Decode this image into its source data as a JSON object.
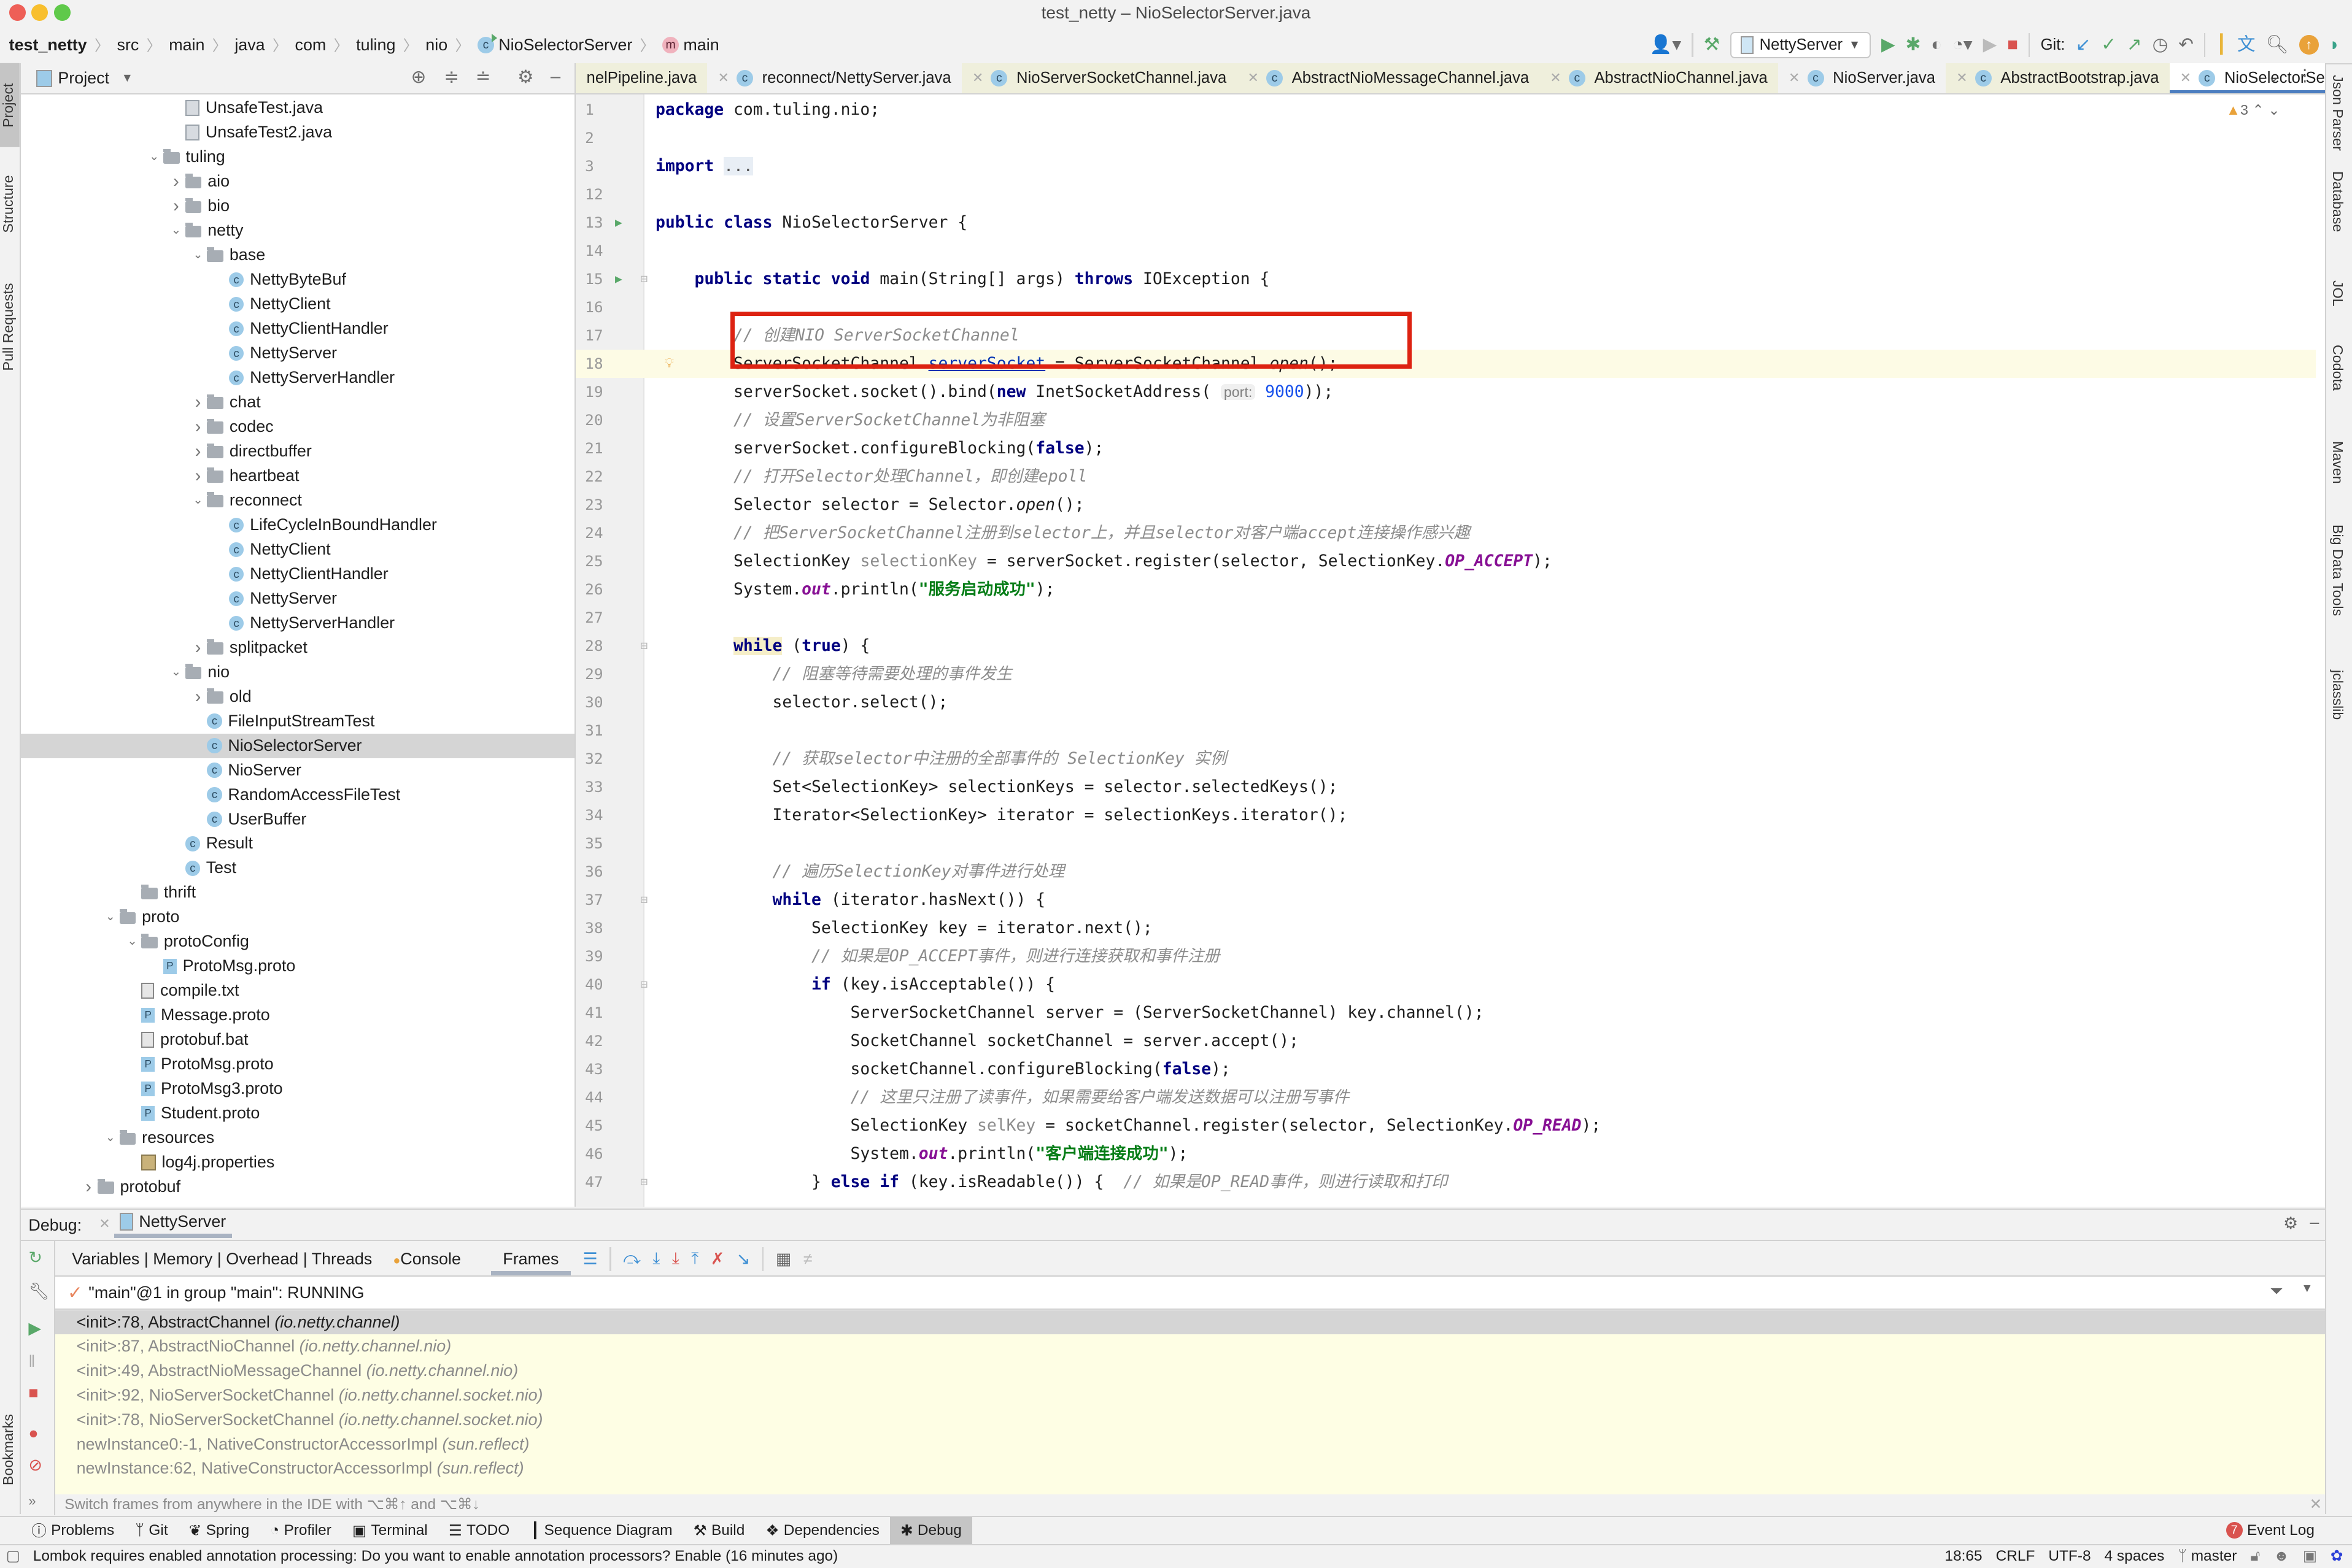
{
  "window": {
    "title": "test_netty – NioSelectorServer.java"
  },
  "colors": {
    "accent": "#4d7ec0",
    "red_box": "#dd2211",
    "close": "#ee5f57",
    "minimize": "#f8bf2e",
    "maximize": "#5fc94a"
  },
  "breadcrumb": [
    "test_netty",
    "src",
    "main",
    "java",
    "com",
    "tuling",
    "nio",
    "NioSelectorServer",
    "main"
  ],
  "toolbar": {
    "run_config": "NettyServer",
    "git_label": "Git:",
    "icons": [
      "user-icon",
      "build-hammer-icon",
      "run-icon",
      "debug-icon",
      "coverage-icon",
      "profile-icon",
      "attach-icon",
      "stop-icon",
      "git-update-icon",
      "git-commit-icon",
      "git-push-icon",
      "history-icon",
      "rollback-icon",
      "sequence-icon",
      "translate-icon",
      "search-icon",
      "update-icon",
      "plugin-icon"
    ]
  },
  "left_strip": [
    "Project",
    "Structure",
    "Pull Requests",
    "Bookmarks"
  ],
  "right_strip": [
    "Json Parser",
    "Database",
    "JOL",
    "Codota",
    "Maven",
    "Big Data Tools",
    "jclasslib"
  ],
  "project": {
    "title": "Project",
    "tree": [
      {
        "label": "UnsafeTest.java",
        "depth": 4,
        "type": "java"
      },
      {
        "label": "UnsafeTest2.java",
        "depth": 4,
        "type": "java"
      },
      {
        "label": "tuling",
        "depth": 3,
        "type": "folder",
        "state": "open"
      },
      {
        "label": "aio",
        "depth": 4,
        "type": "folder",
        "state": "closed"
      },
      {
        "label": "bio",
        "depth": 4,
        "type": "folder",
        "state": "closed"
      },
      {
        "label": "netty",
        "depth": 4,
        "type": "folder",
        "state": "open"
      },
      {
        "label": "base",
        "depth": 5,
        "type": "folder",
        "state": "open"
      },
      {
        "label": "NettyByteBuf",
        "depth": 6,
        "type": "cls"
      },
      {
        "label": "NettyClient",
        "depth": 6,
        "type": "cls"
      },
      {
        "label": "NettyClientHandler",
        "depth": 6,
        "type": "cls"
      },
      {
        "label": "NettyServer",
        "depth": 6,
        "type": "cls"
      },
      {
        "label": "NettyServerHandler",
        "depth": 6,
        "type": "cls"
      },
      {
        "label": "chat",
        "depth": 5,
        "type": "folder",
        "state": "closed"
      },
      {
        "label": "codec",
        "depth": 5,
        "type": "folder",
        "state": "closed"
      },
      {
        "label": "directbuffer",
        "depth": 5,
        "type": "folder",
        "state": "closed"
      },
      {
        "label": "heartbeat",
        "depth": 5,
        "type": "folder",
        "state": "closed"
      },
      {
        "label": "reconnect",
        "depth": 5,
        "type": "folder",
        "state": "open"
      },
      {
        "label": "LifeCycleInBoundHandler",
        "depth": 6,
        "type": "cls"
      },
      {
        "label": "NettyClient",
        "depth": 6,
        "type": "cls"
      },
      {
        "label": "NettyClientHandler",
        "depth": 6,
        "type": "cls"
      },
      {
        "label": "NettyServer",
        "depth": 6,
        "type": "cls"
      },
      {
        "label": "NettyServerHandler",
        "depth": 6,
        "type": "cls"
      },
      {
        "label": "splitpacket",
        "depth": 5,
        "type": "folder",
        "state": "closed"
      },
      {
        "label": "nio",
        "depth": 4,
        "type": "folder",
        "state": "open"
      },
      {
        "label": "old",
        "depth": 5,
        "type": "folder",
        "state": "closed"
      },
      {
        "label": "FileInputStreamTest",
        "depth": 5,
        "type": "cls"
      },
      {
        "label": "NioSelectorServer",
        "depth": 5,
        "type": "cls",
        "selected": true
      },
      {
        "label": "NioServer",
        "depth": 5,
        "type": "cls"
      },
      {
        "label": "RandomAccessFileTest",
        "depth": 5,
        "type": "cls"
      },
      {
        "label": "UserBuffer",
        "depth": 5,
        "type": "cls"
      },
      {
        "label": "Result",
        "depth": 4,
        "type": "cls"
      },
      {
        "label": "Test",
        "depth": 4,
        "type": "cls"
      },
      {
        "label": "thrift",
        "depth": 2,
        "type": "folder"
      },
      {
        "label": "proto",
        "depth": 1,
        "type": "folder",
        "state": "open"
      },
      {
        "label": "protoConfig",
        "depth": 2,
        "type": "folder",
        "state": "open"
      },
      {
        "label": "ProtoMsg.proto",
        "depth": 3,
        "type": "proto"
      },
      {
        "label": "compile.txt",
        "depth": 2,
        "type": "txt"
      },
      {
        "label": "Message.proto",
        "depth": 2,
        "type": "proto"
      },
      {
        "label": "protobuf.bat",
        "depth": 2,
        "type": "txt"
      },
      {
        "label": "ProtoMsg.proto",
        "depth": 2,
        "type": "proto"
      },
      {
        "label": "ProtoMsg3.proto",
        "depth": 2,
        "type": "proto"
      },
      {
        "label": "Student.proto",
        "depth": 2,
        "type": "proto"
      },
      {
        "label": "resources",
        "depth": 1,
        "type": "folder",
        "state": "open"
      },
      {
        "label": "log4j.properties",
        "depth": 2,
        "type": "props"
      },
      {
        "label": "protobuf",
        "depth": 0,
        "type": "folder",
        "state": "closed"
      }
    ]
  },
  "editor": {
    "tabs": [
      {
        "label": "nelPipeline.java",
        "kind": "lib"
      },
      {
        "label": "reconnect/NettyServer.java",
        "kind": "src"
      },
      {
        "label": "NioServerSocketChannel.java",
        "kind": "lib"
      },
      {
        "label": "AbstractNioMessageChannel.java",
        "kind": "lib"
      },
      {
        "label": "AbstractNioChannel.java",
        "kind": "lib"
      },
      {
        "label": "NioServer.java",
        "kind": "src"
      },
      {
        "label": "AbstractBootstrap.java",
        "kind": "lib"
      },
      {
        "label": "NioSelectorServer.java",
        "kind": "active"
      }
    ],
    "warnings": "3",
    "current_line": "18",
    "lines": [
      {
        "n": "1",
        "t": [
          [
            "kw",
            "package"
          ],
          [
            "",
            " com.tuling.nio;"
          ]
        ]
      },
      {
        "n": "2",
        "t": []
      },
      {
        "n": "3",
        "t": [
          [
            "kw",
            "import"
          ],
          [
            "",
            " "
          ],
          [
            "fold",
            "..."
          ]
        ]
      },
      {
        "n": "12",
        "t": []
      },
      {
        "n": "13",
        "t": [
          [
            "kw",
            "public class"
          ],
          [
            "",
            " NioSelectorServer {"
          ]
        ]
      },
      {
        "n": "14",
        "t": []
      },
      {
        "n": "15",
        "t": [
          [
            "",
            "    "
          ],
          [
            "kw",
            "public static void"
          ],
          [
            "",
            " main(String[] args) "
          ],
          [
            "kw",
            "throws"
          ],
          [
            "",
            " IOException {"
          ]
        ]
      },
      {
        "n": "16",
        "t": []
      },
      {
        "n": "17",
        "t": [
          [
            "",
            "        "
          ],
          [
            "cm",
            "// 创建NIO ServerSocketChannel"
          ]
        ]
      },
      {
        "n": "18",
        "t": [
          [
            "",
            "        ServerSocketChannel "
          ],
          [
            "var",
            "serverSocket"
          ],
          [
            "",
            " = ServerSocketChannel."
          ],
          [
            "it",
            "open"
          ],
          [
            "",
            "();"
          ]
        ]
      },
      {
        "n": "19",
        "t": [
          [
            "",
            "        serverSocket.socket().bind("
          ],
          [
            "kw",
            "new"
          ],
          [
            "",
            " InetSocketAddress( "
          ],
          [
            "hint",
            "port:"
          ],
          [
            "",
            " "
          ],
          [
            "num",
            "9000"
          ],
          [
            "",
            "));"
          ]
        ]
      },
      {
        "n": "20",
        "t": [
          [
            "",
            "        "
          ],
          [
            "cm",
            "// 设置ServerSocketChannel为非阻塞"
          ]
        ]
      },
      {
        "n": "21",
        "t": [
          [
            "",
            "        serverSocket.configureBlocking("
          ],
          [
            "kw",
            "false"
          ],
          [
            "",
            ");"
          ]
        ]
      },
      {
        "n": "22",
        "t": [
          [
            "",
            "        "
          ],
          [
            "cm",
            "// 打开Selector处理Channel，即创建epoll"
          ]
        ]
      },
      {
        "n": "23",
        "t": [
          [
            "",
            "        Selector selector = Selector."
          ],
          [
            "it",
            "open"
          ],
          [
            "",
            "();"
          ]
        ]
      },
      {
        "n": "24",
        "t": [
          [
            "",
            "        "
          ],
          [
            "cm",
            "// 把ServerSocketChannel注册到selector上，并且selector对客户端accept连接操作感兴趣"
          ]
        ]
      },
      {
        "n": "25",
        "t": [
          [
            "",
            "        SelectionKey "
          ],
          [
            "un",
            "selectionKey"
          ],
          [
            "",
            " = serverSocket.register(selector, SelectionKey."
          ],
          [
            "fld",
            "OP_ACCEPT"
          ],
          [
            "",
            ");"
          ]
        ]
      },
      {
        "n": "26",
        "t": [
          [
            "",
            "        System."
          ],
          [
            "fld",
            "out"
          ],
          [
            "",
            ".println("
          ],
          [
            "str",
            "\"服务启动成功\""
          ],
          [
            "",
            ");"
          ]
        ]
      },
      {
        "n": "27",
        "t": []
      },
      {
        "n": "28",
        "t": [
          [
            "",
            "        "
          ],
          [
            "kwh",
            "while"
          ],
          [
            "",
            " ("
          ],
          [
            "kw",
            "true"
          ],
          [
            "",
            ") {"
          ]
        ]
      },
      {
        "n": "29",
        "t": [
          [
            "",
            "            "
          ],
          [
            "cm",
            "// 阻塞等待需要处理的事件发生"
          ]
        ]
      },
      {
        "n": "30",
        "t": [
          [
            "",
            "            selector.select();"
          ]
        ]
      },
      {
        "n": "31",
        "t": []
      },
      {
        "n": "32",
        "t": [
          [
            "",
            "            "
          ],
          [
            "cm",
            "// 获取selector中注册的全部事件的 SelectionKey 实例"
          ]
        ]
      },
      {
        "n": "33",
        "t": [
          [
            "",
            "            Set<SelectionKey> selectionKeys = selector.selectedKeys();"
          ]
        ]
      },
      {
        "n": "34",
        "t": [
          [
            "",
            "            Iterator<SelectionKey> iterator = selectionKeys.iterator();"
          ]
        ]
      },
      {
        "n": "35",
        "t": []
      },
      {
        "n": "36",
        "t": [
          [
            "",
            "            "
          ],
          [
            "cm",
            "// 遍历SelectionKey对事件进行处理"
          ]
        ]
      },
      {
        "n": "37",
        "t": [
          [
            "",
            "            "
          ],
          [
            "kw",
            "while"
          ],
          [
            "",
            " (iterator.hasNext()) {"
          ]
        ]
      },
      {
        "n": "38",
        "t": [
          [
            "",
            "                SelectionKey key = iterator.next();"
          ]
        ]
      },
      {
        "n": "39",
        "t": [
          [
            "",
            "                "
          ],
          [
            "cm",
            "// 如果是OP_ACCEPT事件，则进行连接获取和事件注册"
          ]
        ]
      },
      {
        "n": "40",
        "t": [
          [
            "",
            "                "
          ],
          [
            "kw",
            "if"
          ],
          [
            "",
            " (key.isAcceptable()) {"
          ]
        ]
      },
      {
        "n": "41",
        "t": [
          [
            "",
            "                    ServerSocketChannel server = (ServerSocketChannel) key.channel();"
          ]
        ]
      },
      {
        "n": "42",
        "t": [
          [
            "",
            "                    SocketChannel socketChannel = server.accept();"
          ]
        ]
      },
      {
        "n": "43",
        "t": [
          [
            "",
            "                    socketChannel.configureBlocking("
          ],
          [
            "kw",
            "false"
          ],
          [
            "",
            ");"
          ]
        ]
      },
      {
        "n": "44",
        "t": [
          [
            "",
            "                    "
          ],
          [
            "cm",
            "// 这里只注册了读事件，如果需要给客户端发送数据可以注册写事件"
          ]
        ]
      },
      {
        "n": "45",
        "t": [
          [
            "",
            "                    SelectionKey "
          ],
          [
            "un",
            "selKey"
          ],
          [
            "",
            " = socketChannel.register(selector, SelectionKey."
          ],
          [
            "fld",
            "OP_READ"
          ],
          [
            "",
            ");"
          ]
        ]
      },
      {
        "n": "46",
        "t": [
          [
            "",
            "                    System."
          ],
          [
            "fld",
            "out"
          ],
          [
            "",
            ".println("
          ],
          [
            "str",
            "\"客户端连接成功\""
          ],
          [
            "",
            ");"
          ]
        ]
      },
      {
        "n": "47",
        "t": [
          [
            "",
            "                } "
          ],
          [
            "kw",
            "else if"
          ],
          [
            "",
            " (key.isReadable()) {  "
          ],
          [
            "cm",
            "// 如果是OP_READ事件，则进行读取和打印"
          ]
        ]
      }
    ]
  },
  "debug": {
    "label": "Debug:",
    "session": "NettyServer",
    "tabs": [
      "Variables | Memory | Overhead | Threads",
      "Console",
      "Frames"
    ],
    "active_tab": "Frames",
    "thread": "\"main\"@1 in group \"main\": RUNNING",
    "frames": [
      {
        "method": "<init>:78, AbstractChannel ",
        "pkg": "(io.netty.channel)",
        "selected": true
      },
      {
        "method": "<init>:87, AbstractNioChannel ",
        "pkg": "(io.netty.channel.nio)"
      },
      {
        "method": "<init>:49, AbstractNioMessageChannel ",
        "pkg": "(io.netty.channel.nio)"
      },
      {
        "method": "<init>:92, NioServerSocketChannel ",
        "pkg": "(io.netty.channel.socket.nio)"
      },
      {
        "method": "<init>:78, NioServerSocketChannel ",
        "pkg": "(io.netty.channel.socket.nio)"
      },
      {
        "method": "newInstance0:-1, NativeConstructorAccessorImpl ",
        "pkg": "(sun.reflect)"
      },
      {
        "method": "newInstance:62, NativeConstructorAccessorImpl ",
        "pkg": "(sun.reflect)"
      }
    ],
    "hint": "Switch frames from anywhere in the IDE with ⌥⌘↑ and ⌥⌘↓"
  },
  "bottom_tools": [
    {
      "label": "Problems",
      "icon": "problems-icon"
    },
    {
      "label": "Git",
      "icon": "git-icon"
    },
    {
      "label": "Spring",
      "icon": "spring-icon"
    },
    {
      "label": "Profiler",
      "icon": "profiler-icon"
    },
    {
      "label": "Terminal",
      "icon": "terminal-icon"
    },
    {
      "label": "TODO",
      "icon": "todo-icon"
    },
    {
      "label": "Sequence Diagram",
      "icon": "sequence-icon"
    },
    {
      "label": "Build",
      "icon": "build-icon"
    },
    {
      "label": "Dependencies",
      "icon": "dependencies-icon"
    },
    {
      "label": "Debug",
      "icon": "debug-icon",
      "active": true
    }
  ],
  "event_log": {
    "label": "Event Log",
    "count": "7"
  },
  "status": {
    "message": "Lombok requires enabled annotation processing: Do you want to enable annotation processors? Enable (16 minutes ago)",
    "position": "18:65",
    "line_ending": "CRLF",
    "encoding": "UTF-8",
    "indent": "4 spaces",
    "branch": "master"
  }
}
